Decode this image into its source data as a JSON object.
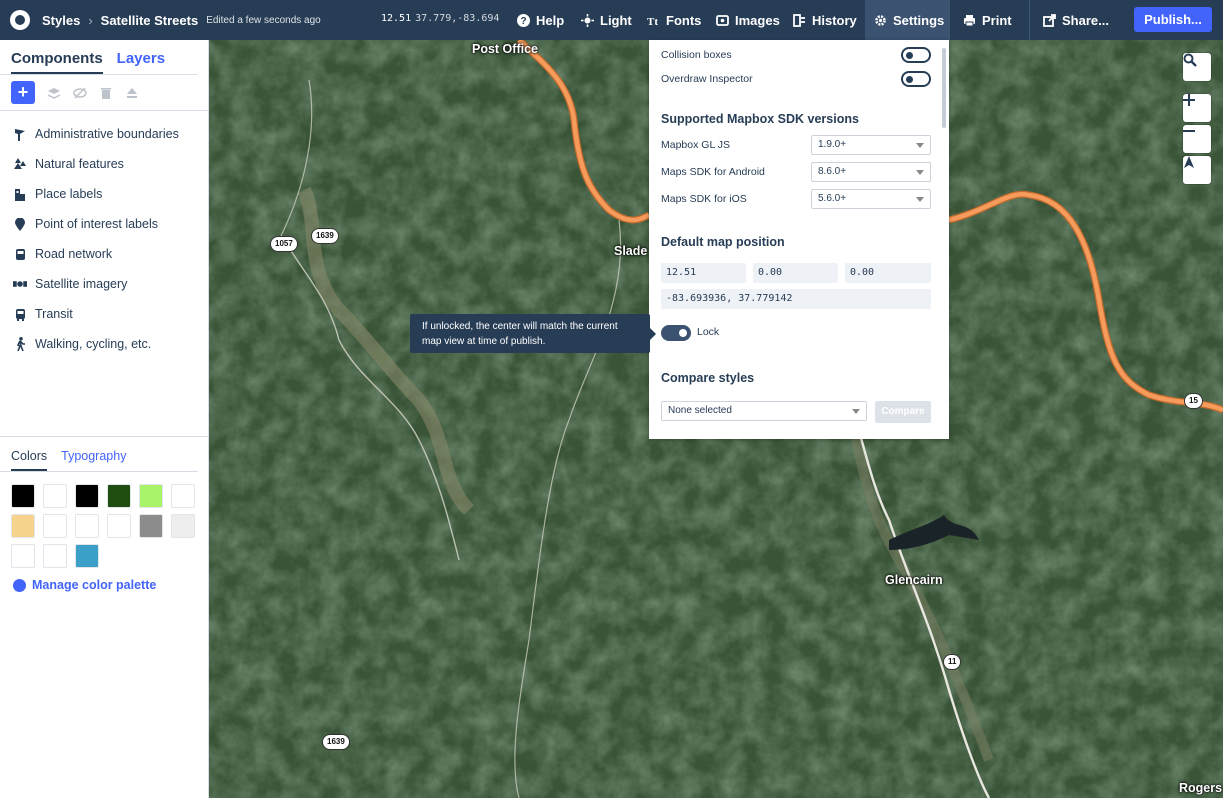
{
  "topbar": {
    "styles_label": "Styles",
    "separator": "›",
    "style_name": "Satellite Streets",
    "edited": "Edited a few seconds ago",
    "zoom": "12.51",
    "center": "37.779,-83.694",
    "nav": {
      "help": "Help",
      "light": "Light",
      "fonts": "Fonts",
      "images": "Images",
      "history": "History",
      "settings": "Settings",
      "print": "Print",
      "share": "Share...",
      "publish": "Publish..."
    }
  },
  "left_panel": {
    "tabs": [
      "Components",
      "Layers"
    ],
    "components": [
      {
        "label": "Administrative boundaries",
        "icon": "flag-icon"
      },
      {
        "label": "Natural features",
        "icon": "trees-icon"
      },
      {
        "label": "Place labels",
        "icon": "buildings-icon"
      },
      {
        "label": "Point of interest labels",
        "icon": "pin-icon"
      },
      {
        "label": "Road network",
        "icon": "car-icon"
      },
      {
        "label": "Satellite imagery",
        "icon": "satellite-icon"
      },
      {
        "label": "Transit",
        "icon": "bus-icon"
      },
      {
        "label": "Walking, cycling, etc.",
        "icon": "walker-icon"
      }
    ],
    "color_tabs": [
      "Colors",
      "Typography"
    ],
    "swatches": [
      "#000000",
      "#ffffff",
      "#000000",
      "#1f4d0f",
      "#a9f36a",
      "#ffffff",
      "#f8d38e",
      "#ffffff",
      "#ffffff",
      "#ffffff",
      "#8c8c8c",
      "#eeeeee",
      "#ffffff",
      "#ffffff",
      "#3b9fc8"
    ],
    "manage_palette": "Manage color palette"
  },
  "map": {
    "labels": [
      "Post Office",
      "Slade",
      "Glencairn",
      "Rogers"
    ],
    "shields": [
      "1057",
      "1639",
      "1639",
      "15",
      "11"
    ]
  },
  "settings": {
    "collision_boxes": "Collision boxes",
    "overdraw_inspector": "Overdraw Inspector",
    "sdk_title": "Supported Mapbox SDK versions",
    "sdk": [
      {
        "label": "Mapbox GL JS",
        "value": "1.9.0+"
      },
      {
        "label": "Maps SDK for Android",
        "value": "8.6.0+"
      },
      {
        "label": "Maps SDK for iOS",
        "value": "5.6.0+"
      }
    ],
    "position_title": "Default map position",
    "zoom": "12.51",
    "bearing": "0.00",
    "pitch": "0.00",
    "center": "-83.693936, 37.779142",
    "lock_label": "Lock",
    "tooltip": "If unlocked, the center will match the current map view at time of publish.",
    "compare_title": "Compare styles",
    "compare_placeholder": "None selected",
    "compare_button": "Compare"
  }
}
